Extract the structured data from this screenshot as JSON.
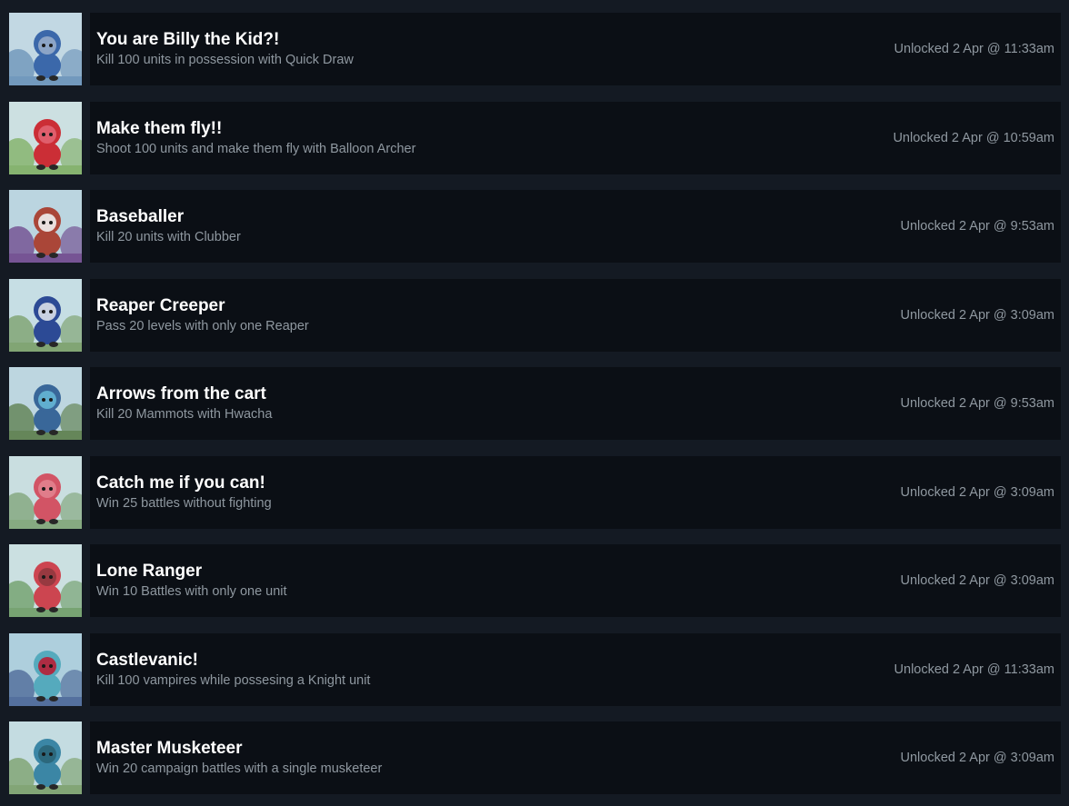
{
  "achievements": [
    {
      "title": "You are Billy the Kid?!",
      "description": "Kill 100 units in possession with Quick Draw",
      "unlocked": "Unlocked 2 Apr @ 11:33am",
      "icon": "billy-the-kid-icon",
      "colors": {
        "sky": "#cfe6f2",
        "ground": "#7aa3c9",
        "body": "#3f6fb5",
        "accent": "#9fb6d6"
      }
    },
    {
      "title": "Make them fly!!",
      "description": "Shoot 100 units and make them fly with Balloon Archer",
      "unlocked": "Unlocked 2 Apr @ 10:59am",
      "icon": "balloon-archer-icon",
      "colors": {
        "sky": "#d9eef0",
        "ground": "#8fbf77",
        "body": "#d8313a",
        "accent": "#f06a7a"
      }
    },
    {
      "title": "Baseballer",
      "description": "Kill 20 units with Clubber",
      "unlocked": "Unlocked 2 Apr @ 9:53am",
      "icon": "clubber-icon",
      "colors": {
        "sky": "#c7e3ef",
        "ground": "#7e5a9e",
        "body": "#b54b3c",
        "accent": "#ffffff"
      }
    },
    {
      "title": "Reaper Creeper",
      "description": "Pass 20 levels with only one Reaper",
      "unlocked": "Unlocked 2 Apr @ 3:09am",
      "icon": "reaper-icon",
      "colors": {
        "sky": "#d3ecf3",
        "ground": "#8ab07c",
        "body": "#2f4f9f",
        "accent": "#e9eef7"
      }
    },
    {
      "title": "Arrows from the cart",
      "description": "Kill 20 Mammots with Hwacha",
      "unlocked": "Unlocked 2 Apr @ 9:53am",
      "icon": "hwacha-icon",
      "colors": {
        "sky": "#c9e4ee",
        "ground": "#6c8f5f",
        "body": "#3d6ea3",
        "accent": "#6bc1e2"
      }
    },
    {
      "title": "Catch me if you can!",
      "description": "Win 25 battles without fighting",
      "unlocked": "Unlocked 2 Apr @ 3:09am",
      "icon": "runner-icon",
      "colors": {
        "sky": "#d6ecef",
        "ground": "#8fb58a",
        "body": "#e05a6c",
        "accent": "#f08a98"
      }
    },
    {
      "title": "Lone Ranger",
      "description": "Win 10 Battles with only one unit",
      "unlocked": "Unlocked 2 Apr @ 3:09am",
      "icon": "lone-ranger-icon",
      "colors": {
        "sky": "#d8eef0",
        "ground": "#7fae7a",
        "body": "#d94a55",
        "accent": "#9a3c42"
      }
    },
    {
      "title": "Castlevanic!",
      "description": "Kill 100 vampires while possesing a Knight unit",
      "unlocked": "Unlocked 2 Apr @ 11:33am",
      "icon": "knight-icon",
      "colors": {
        "sky": "#b9dceb",
        "ground": "#5a78a8",
        "body": "#5bb5c9",
        "accent": "#c3203a"
      }
    },
    {
      "title": "Master Musketeer",
      "description": "Win 20 campaign battles with a single musketeer",
      "unlocked": "Unlocked 2 Apr @ 3:09am",
      "icon": "musketeer-icon",
      "colors": {
        "sky": "#d1eaf0",
        "ground": "#8bb07e",
        "body": "#3f8fb0",
        "accent": "#2d6b7f"
      }
    }
  ]
}
